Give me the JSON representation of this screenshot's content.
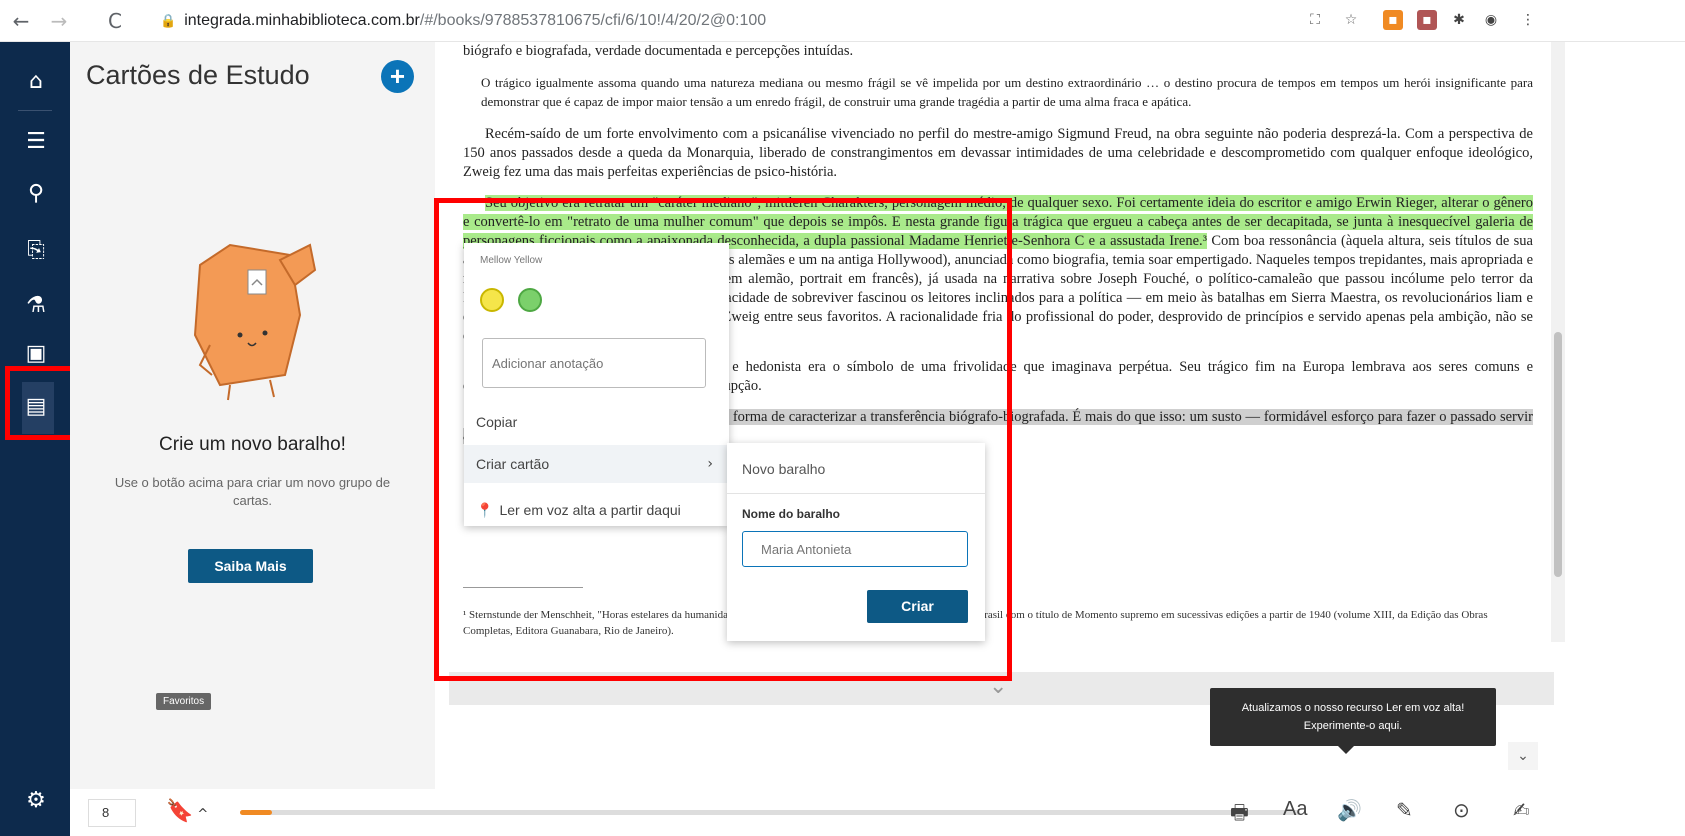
{
  "browser": {
    "back": "←",
    "forward": "→",
    "reload": "C",
    "url_domain": "integrada.minhabiblioteca.com.br",
    "url_path": "/#/books/9788537810675/cfi/6/10!/4/20/2@0:100"
  },
  "rail": {
    "items": [
      {
        "icon": "home-icon",
        "glyph": "⌂"
      },
      {
        "icon": "toc-icon",
        "glyph": "☰"
      },
      {
        "icon": "search-icon",
        "glyph": "⚲"
      },
      {
        "icon": "exit-book-icon",
        "glyph": "⎘"
      },
      {
        "icon": "flask-icon",
        "glyph": "⚗"
      },
      {
        "icon": "figures-icon",
        "glyph": "▣"
      },
      {
        "icon": "flashcards-icon",
        "glyph": "▤"
      }
    ],
    "settings_glyph": "⚙"
  },
  "panel": {
    "title": "Cartões de Estudo",
    "add_glyph": "+",
    "empty_title": "Crie um novo baralho!",
    "empty_subtitle": "Use o botão acima para criar um novo grupo de cartas.",
    "learn_more": "Saiba Mais",
    "favorites_tooltip": "Favoritos"
  },
  "text": {
    "p0": "biógrafo e biografada, verdade documentada e percepções intuídas.",
    "quote": "O trágico igualmente assoma quando uma natureza mediana ou mesmo frágil se vê impelida por um destino extraordinário … o destino procura de tempos em tempos um herói insignificante para demonstrar que é capaz de impor maior tensão a um enredo frágil, de construir uma grande tragédia a partir de uma alma fraca e apática.",
    "p1": "Recém-saído de um forte envolvimento com a psicanálise vivenciado no perfil do mestre-amigo Sigmund Freud, na obra seguinte não poderia desprezá-la. Com a perspectiva de 150 anos passados desde a queda da Monarquia, liberado de constrangimentos em devassar intimidades de uma celebridade e descomprometido com qualquer enfoque ideológico, Zweig fez uma das mais perfeitas experiências de psico-história.",
    "p2_highlight": "Seu objetivo era retratar um \"caráter mediano\", mittleren Charakters, personagem médio, de qualquer sexo. Foi certamente ideia do escritor e amigo Erwin Rieger, alterar o gênero e convertê-lo em \"retrato de uma mulher comum\" que depois se impôs. E nesta grande figura trágica que ergueu a cabeça antes de ser decapitada, se junta à inesquecível galeria de personagens ficcionais como a apaixonada desconhecida, a dupla passional Madame Henriette-Senhora C e a assustada Irene.³",
    "p2_rest": "Com boa ressonância (àquela altura, seis títulos de sua autoria já haviam sido produzidos nos estúdios alemães e um na antiga Hollywood), anunciada como biografia, temia soar empertigado. Naqueles tempos trepidantes, mais apropriada e moderna seria a designação — inexistente em alemão, portrait em francês), já usada na narrativa sobre Joseph Fouché, o político-camaleão que passou incólume pelo terror da Revolução e o período napoleônico. Sua capacidade de sobreviver fascinou os leitores inclinados para a política — em meio às batalhas em Sierra Maestra, os revolucionários liam e discutiam a boa literatura, tendo Fouché de Zweig entre seus favoritos. A racionalidade fria do profissional do poder, desprovido de princípios e servido apenas pela ambição, não se distinguia do desatino dos fanáticos.",
    "p3": "A rainha absolutista, perdulária, fogosa e hedonista era o símbolo de uma frivolidade que imaginava perpétua. Seu trágico fim na Europa lembrava aos seres comuns e despreocupados que o vulcão já estava em erupção.",
    "p4_gray": "Marie Antoinette c'est moi, seria a melhor forma de caracterizar a transferência biógrafo-biografada. É mais do que isso: um susto — formidável esforço para fazer o passado servir ao presente.",
    "footnote": "¹ Sternstunde der Menschheit, \"Horas estelares da humanidade\", coletânea de miniaturas históricas, foi publicada no Brasil com o título de Momento supremo em sucessivas edições a partir de 1940 (volume XIII, da Edição das Obras Completas, Editora Guanabara, Rio de Janeiro)."
  },
  "context_menu": {
    "color_name": "Mellow Yellow",
    "note_placeholder": "Adicionar anotação",
    "copy": "Copiar",
    "create_card": "Criar cartão",
    "create_card_arrow": "›",
    "read_aloud": "Ler em voz alta a partir daqui",
    "swatches": [
      "#f5e54a",
      "#7bd06b"
    ]
  },
  "submenu": {
    "new_deck": "Novo baralho",
    "deck_name_label": "Nome do baralho",
    "deck_name_placeholder": "Maria Antonieta",
    "create": "Criar"
  },
  "bottom": {
    "page": "8",
    "progress": 0.03,
    "notice": "Atualizamos o nosso recurso Ler em voz alta! Experimente-o aqui.",
    "tools": [
      "print-icon",
      "font-size-icon",
      "read-aloud-icon",
      "highlighter-icon",
      "more-icon",
      "notes-icon"
    ]
  }
}
